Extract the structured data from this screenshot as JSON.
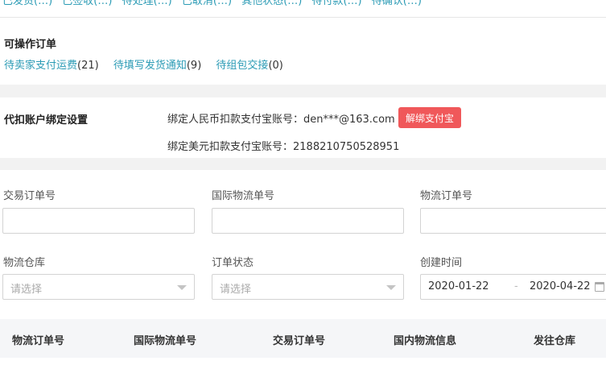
{
  "top_tabs": [
    {
      "label": "已发货(…)"
    },
    {
      "label": "已签收(…)"
    },
    {
      "label": "待处理(…)"
    },
    {
      "label": "已取消(…)"
    },
    {
      "label": "其他状态(…)"
    },
    {
      "label": "待付款(…)"
    },
    {
      "label": "待确认(…)"
    }
  ],
  "actionable": {
    "title": "可操作订单",
    "links": [
      {
        "label": "待卖家支付运费",
        "count": "(21)"
      },
      {
        "label": "待填写发货通知",
        "count": "(9)"
      },
      {
        "label": "待组包交接",
        "count": "(0)"
      }
    ]
  },
  "binding": {
    "title": "代扣账户绑定设置",
    "rmb_account": "绑定人民币扣款支付宝账号：den***@163.com",
    "usd_account": "绑定美元扣款支付宝账号：2188210750528951",
    "unbind_button": "解绑支付宝"
  },
  "filters": {
    "trade_order_no": {
      "label": "交易订单号",
      "value": ""
    },
    "intl_tracking_no": {
      "label": "国际物流单号",
      "value": ""
    },
    "logistics_order_no": {
      "label": "物流订单号",
      "value": ""
    },
    "warehouse": {
      "label": "物流仓库",
      "placeholder": "请选择"
    },
    "order_status": {
      "label": "订单状态",
      "placeholder": "请选择"
    },
    "created_time": {
      "label": "创建时间",
      "start": "2020-01-22",
      "separator": "-",
      "end": "2020-04-22"
    }
  },
  "table": {
    "columns": [
      "物流订单号",
      "国际物流单号",
      "交易订单号",
      "国内物流信息",
      "发往仓库"
    ]
  }
}
